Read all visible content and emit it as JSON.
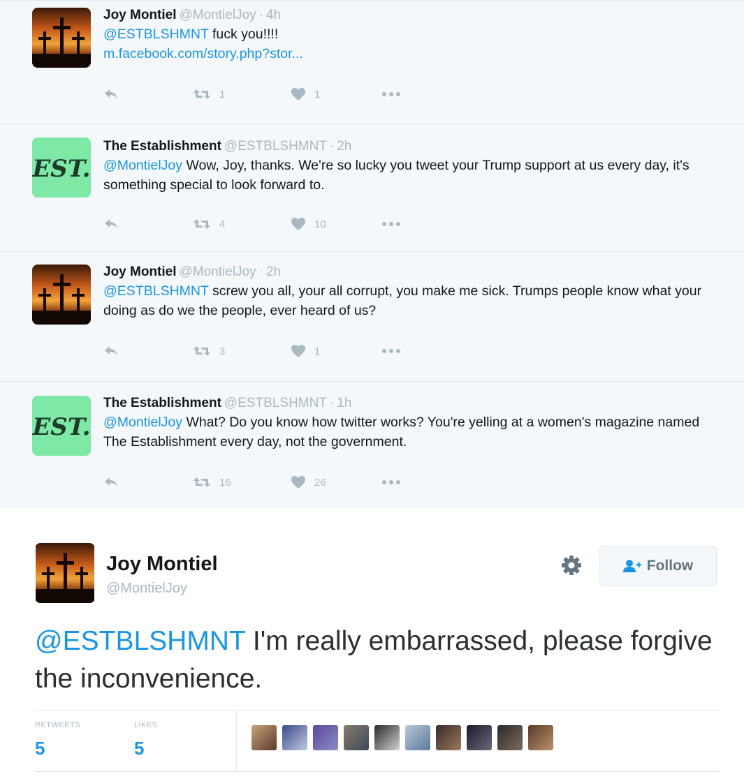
{
  "thread": [
    {
      "name": "Joy Montiel",
      "handle": "@MontielJoy",
      "dot": "·",
      "time": "4h",
      "mention": "@ESTBLSHMNT",
      "text": "fuck you!!!!",
      "link": "m.facebook.com/story.php?stor...",
      "retweets": "1",
      "likes": "1",
      "avatar": "cross-sunset"
    },
    {
      "name": "The Establishment",
      "handle": "@ESTBLSHMNT",
      "dot": "·",
      "time": "2h",
      "mention": "@MontielJoy",
      "text": "Wow, Joy, thanks. We're so lucky you tweet your Trump support at us every day, it's something special to look forward to.",
      "retweets": "4",
      "likes": "10",
      "avatar": "est-logo"
    },
    {
      "name": "Joy Montiel",
      "handle": "@MontielJoy",
      "dot": "·",
      "time": "2h",
      "mention": "@ESTBLSHMNT",
      "text": "screw you all, your all corrupt, you make me sick.  Trumps people know what your doing as do we the people, ever heard of us?",
      "retweets": "3",
      "likes": "1",
      "avatar": "cross-sunset"
    },
    {
      "name": "The Establishment",
      "handle": "@ESTBLSHMNT",
      "dot": "·",
      "time": "1h",
      "mention": "@MontielJoy",
      "text": "What? Do you know how twitter works? You're yelling at a women's magazine named The Establishment every day, not the government.",
      "retweets": "16",
      "likes": "26",
      "avatar": "est-logo"
    }
  ],
  "permalink": {
    "name": "Joy Montiel",
    "handle": "@MontielJoy",
    "follow_label": "Follow",
    "mention": "@ESTBLSHMNT",
    "text": " I'm really embarrassed, please forgive the inconvenience.",
    "retweets_label": "RETWEETS",
    "retweets": "5",
    "likes_label": "LIKES",
    "likes": "5"
  },
  "colors": {
    "link": "#1b95e0",
    "muted": "#aab8c2",
    "est_green": "#7ee8a6",
    "thread_bg": "#f5f8fa"
  },
  "icons": [
    "reply-icon",
    "retweet-icon",
    "heart-icon",
    "more-icon",
    "gear-icon",
    "follow-icon"
  ]
}
